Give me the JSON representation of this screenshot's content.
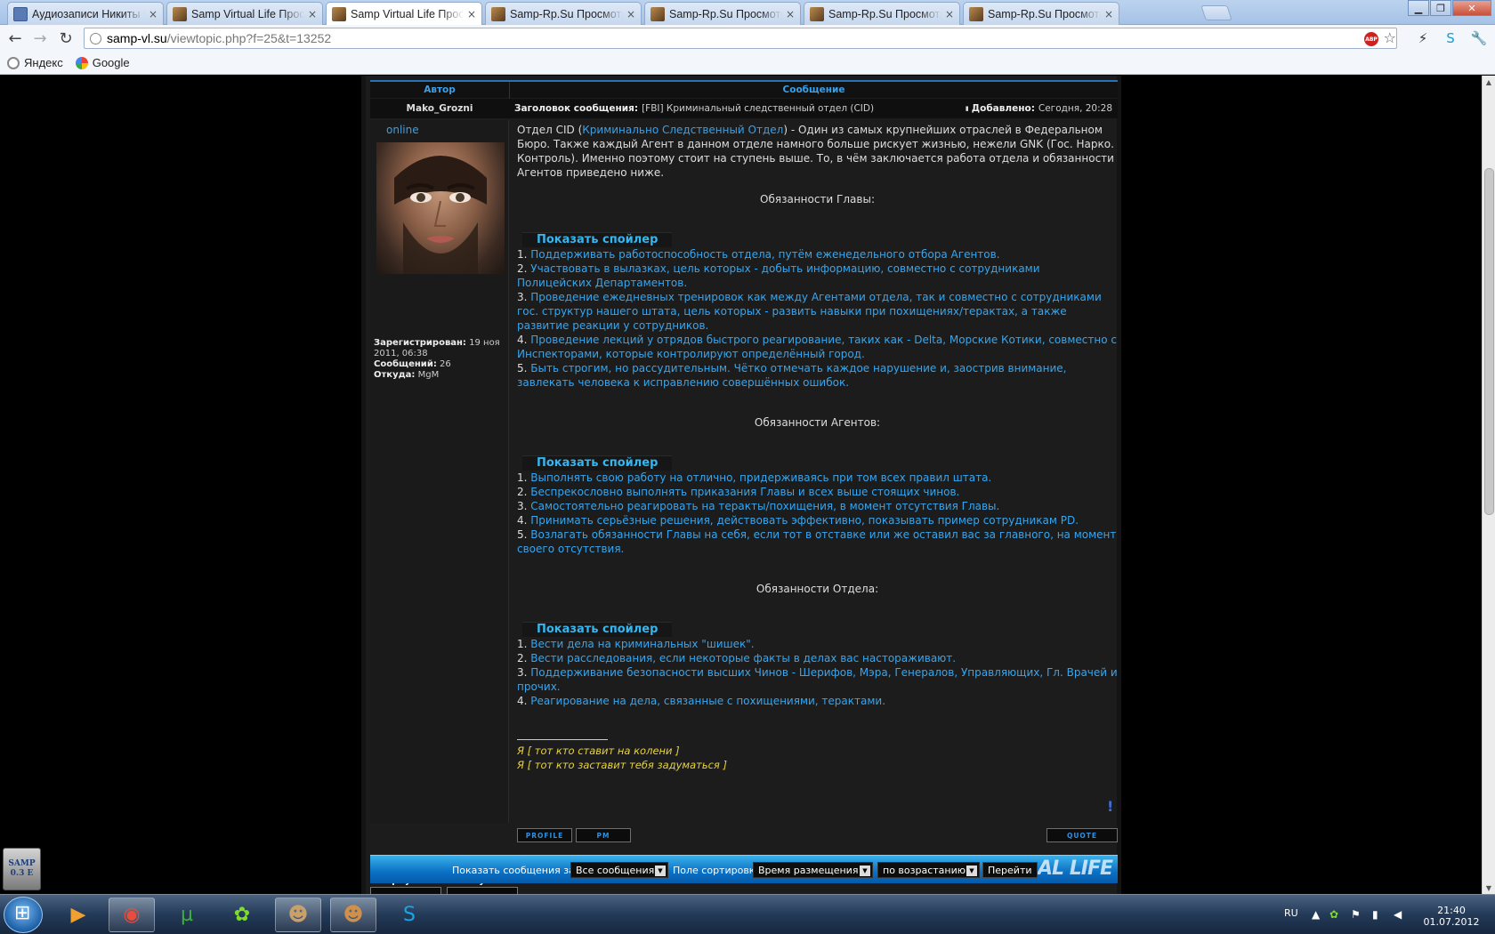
{
  "browser": {
    "tabs": [
      {
        "label": "Аудиозаписи Никиты Фо",
        "icon": "vk-favicon",
        "active": false
      },
      {
        "label": "Samp Virtual Life Просмот",
        "icon": "samp-favicon",
        "active": false
      },
      {
        "label": "Samp Virtual Life Просмот",
        "icon": "samp-favicon",
        "active": true
      },
      {
        "label": "Samp-Rp.Su Просмотр ф",
        "icon": "samp-favicon",
        "active": false
      },
      {
        "label": "Samp-Rp.Su Просмотр ф",
        "icon": "samp-favicon",
        "active": false
      },
      {
        "label": "Samp-Rp.Su Просмотр ф",
        "icon": "samp-favicon",
        "active": false
      },
      {
        "label": "Samp-Rp.Su Просмотр ф",
        "icon": "samp-favicon",
        "active": false
      }
    ],
    "tab_close": "×",
    "url_host": "samp-vl.su",
    "url_path": "/viewtopic.php?f=25&t=13252",
    "abp_label": "ABP",
    "bookmarks": [
      {
        "label": "Яндекс",
        "icon": "yandex-icon"
      },
      {
        "label": "Google",
        "icon": "google-icon"
      }
    ]
  },
  "forum": {
    "col_author": "Автор",
    "col_message": "Сообщение",
    "author": "Mako_Grozni",
    "subject_label": "Заголовок сообщения:",
    "subject": "[FBI] Криминальный следственный отдел (CID)",
    "date_label": "Добавлено:",
    "date": "Сегодня, 20:28",
    "status": "online",
    "profile": {
      "registered_label": "Зарегистрирован:",
      "registered": "19 ноя 2011, 06:38",
      "posts_label": "Сообщений:",
      "posts": "26",
      "from_label": "Откуда:",
      "from": "MgM"
    },
    "back_to_top": "Вернуться к началу",
    "intro_part1": "Отдел CID (",
    "intro_link": "Криминально Следственный Отдел",
    "intro_part2": ") - Один из самых крупнейших отраслей в Федеральном Бюро. Также каждый Агент в данном отделе намного больше рискует жизнью, нежели GNK (Гос. Нарко. Контроль). Именно поэтому стоит на ступень выше. То, в чём заключается работа отдела и обязанности Агентов приведено ниже.",
    "spoiler_label": "Показать спойлер",
    "sections": [
      {
        "title": "Обязанности Главы:",
        "items": [
          "Поддерживать работоспособность отдела, путём еженедельного отбора Агентов.",
          "Участвовать в вылазках, цель которых - добыть информацию, совместно с сотрудниками Полицейских Департаментов.",
          "Проведение ежедневных тренировок как между Агентами отдела, так и совместно с сотрудниками гос. структур нашего штата, цель которых - развить навыки при похищениях/терактах, а также развитие реакции у сотрудников.",
          "Проведение лекций у отрядов быстрого реагирование, таких как - Delta, Морские Котики, совместно с Инспекторами, которые контролируют определённый город.",
          "Быть строгим, но рассудительным. Чётко отмечать каждое нарушение и, заострив внимание, завлекать человека к исправлению совершённых ошибок."
        ]
      },
      {
        "title": "Обязанности Агентов:",
        "items": [
          "Выполнять свою работу на отлично, придерживаясь при том всех правил штата.",
          "Беспрекословно выполнять приказания Главы и всех выше стоящих чинов.",
          "Самостоятельно реагировать на теракты/похищения, в момент отсутствия Главы.",
          "Принимать серьёзные решения, действовать эффективно, показывать пример сотрудникам PD.",
          "Возлагать обязанности Главы на себя, если тот в отставке или же оставил вас за главного, на момент своего отсутствия."
        ]
      },
      {
        "title": "Обязанности Отдела:",
        "items": [
          "Вести дела на криминальных \"шишек\".",
          "Вести расследования, если некоторые факты в делах вас настораживают.",
          "Поддерживание безопасности высших Чинов - Шерифов, Мэра, Генералов, Управляющих, Гл. Врачей и прочих.",
          "Реагирование на дела, связанные с похищениями, терактами."
        ]
      }
    ],
    "signature": [
      "Я [ тот кто ставит на колени ]",
      "Я [ тот кто заставит тебя задуматься ]"
    ],
    "report_mark": "!",
    "btn_profile": "PROFILE",
    "btn_pm": "PM",
    "btn_quote": "QUOTE",
    "show_messages_label": "Показать сообщения за:",
    "show_messages_value": "Все сообщения",
    "sort_field_label": "Поле сортировки",
    "sort_field_value": "Время размещения",
    "sort_order_value": "по возрастанию",
    "go_button": "Перейти",
    "banner_text": "AL LIFE"
  },
  "samp_badge": {
    "line1": "SAMP",
    "line2": "0.3 E"
  },
  "taskbar": {
    "lang": "RU",
    "time": "21:40",
    "date": "01.07.2012"
  },
  "colors": {
    "accent": "#3aa0e8",
    "list": "#35a6f0",
    "signature": "#e8d33c",
    "banner": "#0a6fc4"
  }
}
